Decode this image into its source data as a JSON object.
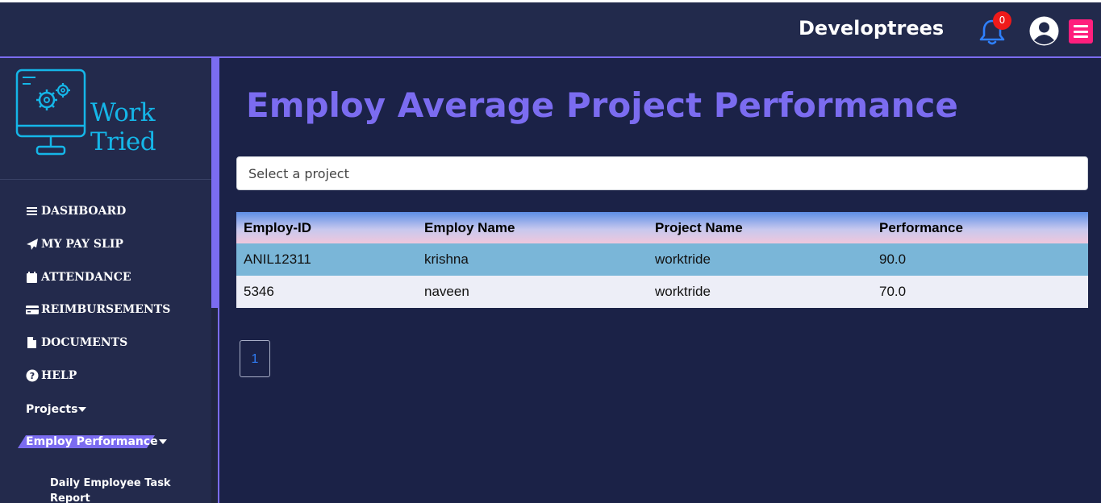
{
  "header": {
    "brand": "Developtrees",
    "notification_count": "0"
  },
  "logo": {
    "text": "Work Tried"
  },
  "sidebar": {
    "items": [
      {
        "label": "DASHBOARD",
        "icon": "bars-icon"
      },
      {
        "label": "MY PAY SLIP",
        "icon": "paper-plane-icon"
      },
      {
        "label": "ATTENDANCE",
        "icon": "calendar-icon"
      },
      {
        "label": "REIMBURSEMENTS",
        "icon": "credit-card-icon"
      },
      {
        "label": "DOCUMENTS",
        "icon": "file-icon"
      },
      {
        "label": "HELP",
        "icon": "question-circle-icon"
      }
    ],
    "projects_label": "Projects",
    "employ_performance_label": "Employ Performance",
    "sub_item_label": "Daily Employee Task Report"
  },
  "main": {
    "title": "Employ Average Project Performance",
    "select_placeholder": "Select a project",
    "table": {
      "columns": [
        "Employ-ID",
        "Employ Name",
        "Project Name",
        "Performance"
      ],
      "rows": [
        [
          "ANIL12311",
          "krishna",
          "worktride",
          "90.0"
        ],
        [
          "5346",
          "naveen",
          "worktride",
          "70.0"
        ]
      ]
    },
    "pagination": {
      "current_page": "1"
    }
  },
  "colors": {
    "accent": "#7b6cf0",
    "background": "#1b2247",
    "badge": "#ef1a1a",
    "menu_button": "#ff1f7d",
    "logo": "#15b6e8"
  }
}
